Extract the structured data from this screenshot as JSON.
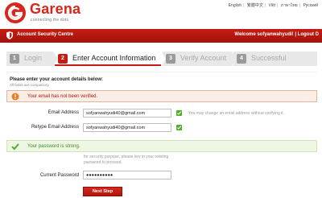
{
  "brand": {
    "name": "Garena",
    "tagline": "connecting the dots",
    "accent": "#d8261c"
  },
  "languages": [
    "English",
    "繁體中文",
    "Việt",
    "ภาษาไทย",
    "Русский"
  ],
  "topbar": {
    "title": "Account Security Centre",
    "welcome": "Welcome sofyanwahyudi! | Logout D"
  },
  "steps": [
    {
      "num": "1",
      "label": "Login",
      "state": "done"
    },
    {
      "num": "2",
      "label": "Enter Account Information",
      "state": "active"
    },
    {
      "num": "3",
      "label": "Verify Account",
      "state": "pending"
    },
    {
      "num": "4",
      "label": "Successful",
      "state": "pending"
    }
  ],
  "form": {
    "title": "Please enter your account details below:",
    "subtitle": "All fields are compulsory",
    "warning": "Your email has not been verified.",
    "email_label": "Email Address",
    "email_value": "sofyanwahyudi40@gmail.com",
    "email_hint": "You may change an email address without verifying it.",
    "retype_label": "Retype Email Address",
    "retype_value": "sofyanwahyudi40@gmail.com",
    "success": "Your password is strong.",
    "note": "for security purpose, please key in your existing password to proceed.",
    "password_label": "Current Password",
    "password_value": "●●●●●●●●●●",
    "next_button": "Next Step"
  }
}
